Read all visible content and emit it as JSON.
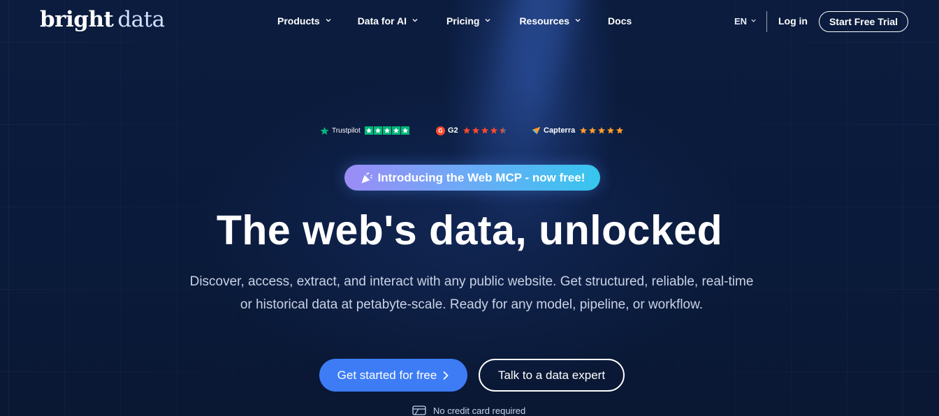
{
  "header": {
    "logo_word1": "bright",
    "logo_word2": "data",
    "nav": [
      {
        "label": "Products"
      },
      {
        "label": "Data for AI"
      },
      {
        "label": "Pricing"
      },
      {
        "label": "Resources"
      },
      {
        "label": "Docs"
      }
    ],
    "language": "EN",
    "login": "Log in",
    "cta": "Start Free Trial"
  },
  "ratings": {
    "trustpilot": {
      "name": "Trustpilot",
      "stars": 5
    },
    "g2": {
      "logo": "G",
      "name": "G2",
      "stars": 4.5
    },
    "capterra": {
      "name": "Capterra",
      "stars": 5
    }
  },
  "announcement": {
    "icon": "party-popper-icon",
    "text": "Introducing the Web MCP - now free!"
  },
  "hero": {
    "title": "The web's data, unlocked",
    "subtitle_line1": "Discover, access, extract, and interact with any public website. Get structured, reliable, real-time",
    "subtitle_line2": "or historical data at petabyte-scale. Ready for any model, pipeline, or workflow.",
    "primary_cta": "Get started for free",
    "secondary_cta": "Talk to a data expert",
    "note": "No credit card required"
  },
  "colors": {
    "background": "#0b1a3a",
    "primary_button": "#3d7cf5",
    "trustpilot_green": "#00b67a",
    "g2_red": "#ff492c",
    "g2_star": "#ff492c",
    "capterra_star": "#ff9d28",
    "pill_gradient_start": "#9b8cf5",
    "pill_gradient_end": "#36c6ee"
  }
}
